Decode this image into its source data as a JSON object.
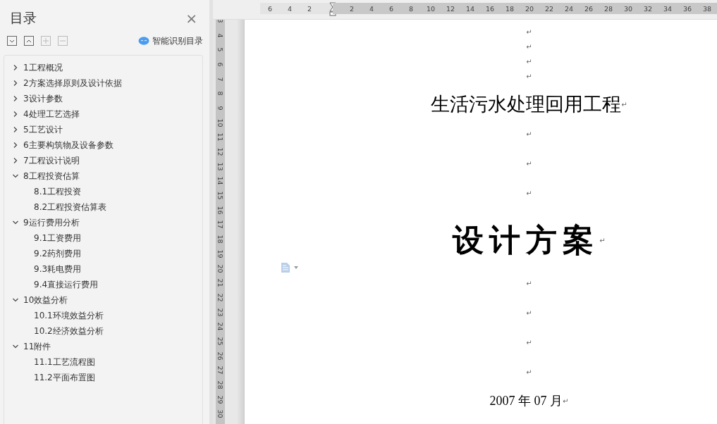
{
  "toc": {
    "title": "目录",
    "close": "×",
    "tools": [
      {
        "kind": "expand-all",
        "disabled": false
      },
      {
        "kind": "collapse-all",
        "disabled": false
      },
      {
        "kind": "promote",
        "disabled": true
      },
      {
        "kind": "demote",
        "disabled": true
      }
    ],
    "smart_button": "智能识别目录",
    "items": [
      {
        "label": "1工程概况",
        "expanded": false
      },
      {
        "label": "2方案选择原则及设计依据",
        "expanded": false
      },
      {
        "label": "3设计参数",
        "expanded": false
      },
      {
        "label": "4处理工艺选择",
        "expanded": false
      },
      {
        "label": "5工艺设计",
        "expanded": false
      },
      {
        "label": "6主要构筑物及设备参数",
        "expanded": false
      },
      {
        "label": "7工程设计说明",
        "expanded": false
      },
      {
        "label": "8工程投资估算",
        "expanded": true,
        "children": [
          {
            "label": "8.1工程投资"
          },
          {
            "label": "8.2工程投资估算表"
          }
        ]
      },
      {
        "label": "9运行费用分析",
        "expanded": true,
        "children": [
          {
            "label": "9.1工资费用"
          },
          {
            "label": "9.2药剂费用"
          },
          {
            "label": "9.3耗电费用"
          },
          {
            "label": "9.4直接运行费用"
          }
        ]
      },
      {
        "label": "10效益分析",
        "expanded": true,
        "children": [
          {
            "label": "10.1环境效益分析"
          },
          {
            "label": "10.2经济效益分析"
          }
        ]
      },
      {
        "label": "11附件",
        "expanded": true,
        "children": [
          {
            "label": "11.1工艺流程图"
          },
          {
            "label": "11.2平面布置图"
          }
        ]
      }
    ]
  },
  "ruler": {
    "left_labels": [
      "6",
      "4",
      "2"
    ],
    "right_labels": [
      "2",
      "4",
      "6",
      "8",
      "10",
      "12",
      "14",
      "16",
      "18",
      "20",
      "22",
      "24",
      "26",
      "28",
      "30",
      "32",
      "34",
      "36",
      "38"
    ],
    "vertical_labels": [
      "3",
      "4",
      "5",
      "6",
      "7",
      "8",
      "9",
      "10",
      "11",
      "12",
      "13",
      "14",
      "15",
      "16",
      "17",
      "18",
      "19",
      "20",
      "21",
      "22",
      "23",
      "24",
      "25",
      "26",
      "27",
      "28",
      "29",
      "30"
    ]
  },
  "document": {
    "paragraphs": [
      {
        "kind": "blank",
        "mark": "↵"
      },
      {
        "kind": "blank",
        "mark": "↵"
      },
      {
        "kind": "blank",
        "mark": "↵"
      },
      {
        "kind": "blank",
        "mark": "↵"
      },
      {
        "kind": "title",
        "text": "生活污水处理回用工程",
        "mark": "↵"
      },
      {
        "kind": "gap",
        "mark": "↵"
      },
      {
        "kind": "gap",
        "mark": "↵"
      },
      {
        "kind": "gap",
        "mark": "↵"
      },
      {
        "kind": "headline",
        "text": "设计方案",
        "mark": "↵"
      },
      {
        "kind": "gap",
        "mark": "↵"
      },
      {
        "kind": "gap",
        "mark": "↵"
      },
      {
        "kind": "gap",
        "mark": "↵"
      },
      {
        "kind": "gap",
        "mark": "↵"
      },
      {
        "kind": "date",
        "text": "2007 年 07 月",
        "mark": "↵"
      }
    ]
  }
}
